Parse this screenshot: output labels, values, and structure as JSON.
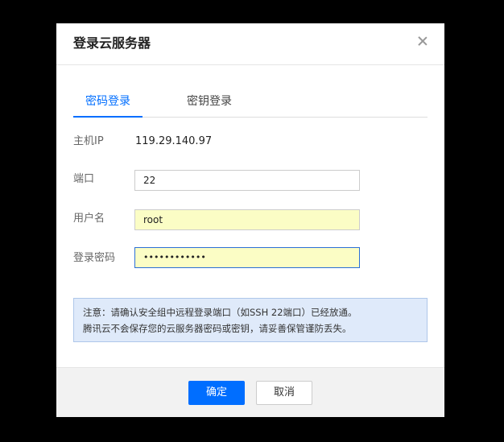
{
  "dialog": {
    "title": "登录云服务器"
  },
  "tabs": {
    "password_login": "密码登录",
    "key_login": "密钥登录"
  },
  "form": {
    "host_ip_label": "主机IP",
    "host_ip_value": "119.29.140.97",
    "port_label": "端口",
    "port_value": "22",
    "username_label": "用户名",
    "username_value": "root",
    "password_label": "登录密码",
    "password_value": "••••••••••••"
  },
  "notice": {
    "line1": "注意：请确认安全组中远程登录端口（如SSH 22端口）已经放通。",
    "line2": "腾讯云不会保存您的云服务器密码或密钥，请妥善保管谨防丢失。"
  },
  "footer": {
    "confirm_label": "确定",
    "cancel_label": "取消"
  },
  "colors": {
    "accent": "#006eff",
    "notice_bg": "#dfeafa",
    "autofill_bg": "#fbfdc5"
  }
}
